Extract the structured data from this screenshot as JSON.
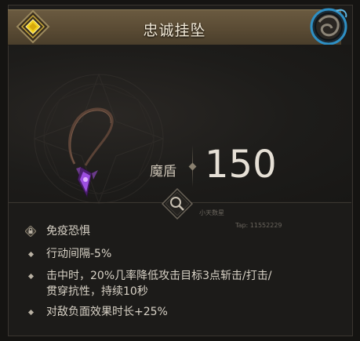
{
  "item": {
    "name": "忠诚挂坠",
    "stat_label": "魔盾",
    "stat_value": "150"
  },
  "affixes": [
    {
      "text": "免疫恐惧",
      "icon": "lock-icon"
    },
    {
      "text": "行动间隔-5%",
      "icon": "diamond-bullet"
    },
    {
      "text_line1": "击中时，20%几率降低攻击目标3点斩击/打击/",
      "text_line2": "贯穿抗性，持续10秒",
      "icon": "diamond-bullet"
    },
    {
      "text": "对敌负面效果时长+25%",
      "icon": "diamond-bullet"
    }
  ],
  "watermark": {
    "line1": "小天数星",
    "line2": "Tap:  11552229"
  },
  "colors": {
    "header": "#5a4b34",
    "title": "#f3ead8",
    "rarity": "#e4c21a",
    "amulet": "#8b3fd6"
  }
}
